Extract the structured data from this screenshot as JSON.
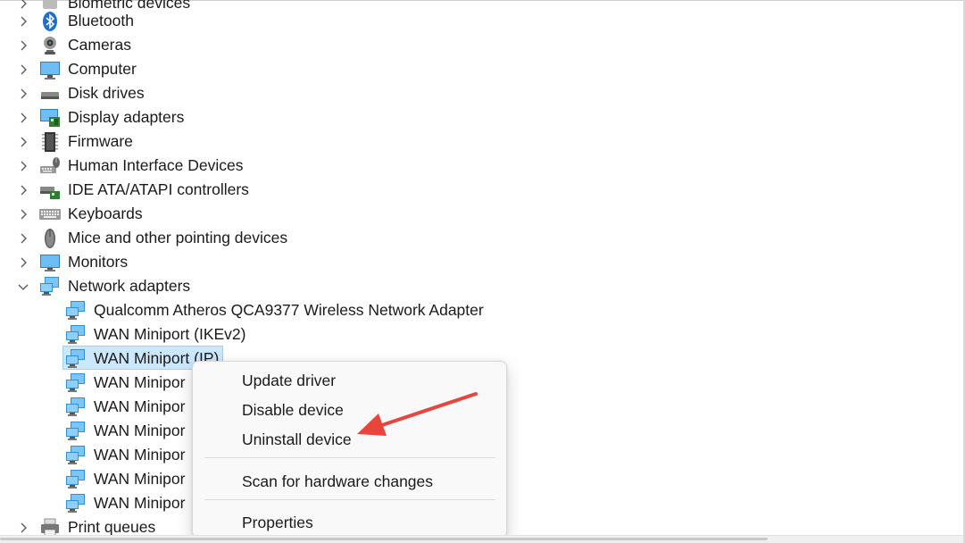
{
  "tree": {
    "categories": [
      {
        "label": "Biometric devices",
        "icon": "biometric-icon",
        "expanded": false
      },
      {
        "label": "Bluetooth",
        "icon": "bluetooth-icon",
        "expanded": false
      },
      {
        "label": "Cameras",
        "icon": "camera-icon",
        "expanded": false
      },
      {
        "label": "Computer",
        "icon": "computer-icon",
        "expanded": false
      },
      {
        "label": "Disk drives",
        "icon": "disk-drive-icon",
        "expanded": false
      },
      {
        "label": "Display adapters",
        "icon": "display-adapter-icon",
        "expanded": false
      },
      {
        "label": "Firmware",
        "icon": "firmware-icon",
        "expanded": false
      },
      {
        "label": "Human Interface Devices",
        "icon": "hid-icon",
        "expanded": false
      },
      {
        "label": "IDE ATA/ATAPI controllers",
        "icon": "ide-controller-icon",
        "expanded": false
      },
      {
        "label": "Keyboards",
        "icon": "keyboard-icon",
        "expanded": false
      },
      {
        "label": "Mice and other pointing devices",
        "icon": "mouse-icon",
        "expanded": false
      },
      {
        "label": "Monitors",
        "icon": "monitor-icon",
        "expanded": false
      },
      {
        "label": "Network adapters",
        "icon": "network-adapter-icon",
        "expanded": true
      },
      {
        "label": "Print queues",
        "icon": "printer-icon",
        "expanded": false
      }
    ],
    "network_children": [
      "Qualcomm Atheros QCA9377 Wireless Network Adapter",
      "WAN Miniport (IKEv2)",
      "WAN Miniport (IP)",
      "WAN Minipor",
      "WAN Minipor",
      "WAN Minipor",
      "WAN Minipor",
      "WAN Minipor",
      "WAN Minipor"
    ],
    "selected_child": "WAN Miniport (IP)"
  },
  "context_menu": {
    "items": [
      {
        "label": "Update driver"
      },
      {
        "label": "Disable device"
      },
      {
        "label": "Uninstall device",
        "highlighted_by_arrow": true
      },
      {
        "label": "Scan for hardware changes"
      },
      {
        "label": "Properties"
      }
    ]
  },
  "colors": {
    "selection_bg": "#cce8ff",
    "selection_border": "#99d1ff",
    "annotation_arrow": "#e8453c",
    "network_icon": "#2f8fd8"
  }
}
